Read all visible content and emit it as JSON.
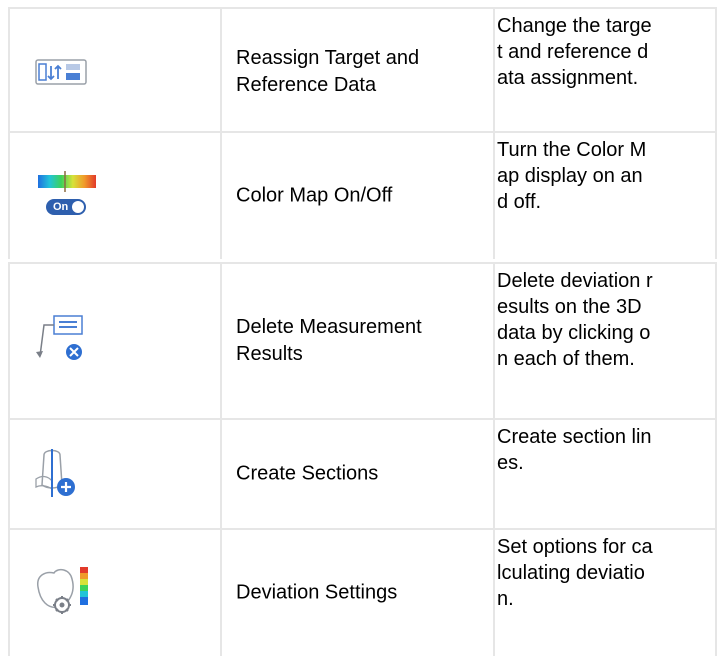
{
  "rows": [
    {
      "icon": "reassign-data-icon",
      "name": "Reassign Target and Reference Data",
      "desc_lines": [
        "Change the targe",
        "t and reference d",
        "ata assignment."
      ]
    },
    {
      "icon": "color-map-toggle-icon",
      "name": "Color Map On/Off",
      "desc_lines": [
        "Turn the Color M",
        "ap display on an",
        "d off."
      ],
      "toggle_label": "On"
    },
    {
      "icon": "delete-results-icon",
      "name": "Delete Measurement Results",
      "desc_lines": [
        "Delete deviation r",
        "esults on the 3D",
        "data by clicking o",
        "n each of them."
      ]
    },
    {
      "icon": "create-sections-icon",
      "name": "Create Sections",
      "desc_lines": [
        "Create section lin",
        "es."
      ]
    },
    {
      "icon": "deviation-settings-icon",
      "name": "Deviation Settings",
      "desc_lines": [
        "Set options for ca",
        "lculating deviatio",
        "n."
      ]
    }
  ],
  "colors": {
    "icon_blue": "#2e6fd1",
    "icon_outline": "#7a7f88",
    "grid": "#e6e6e6"
  }
}
